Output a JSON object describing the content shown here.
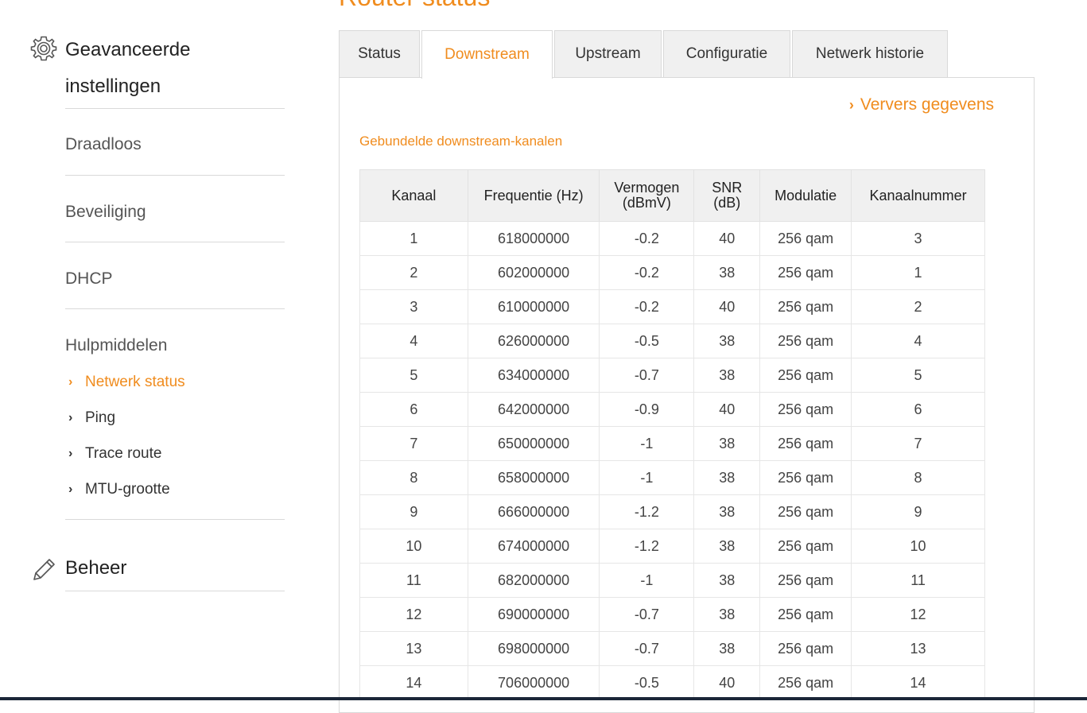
{
  "page_title": "Router status",
  "sidebar": {
    "advanced": {
      "title": "Geavanceerde instellingen",
      "icon": "gear-icon",
      "links": [
        "Draadloos",
        "Beveiliging",
        "DHCP"
      ],
      "tools": {
        "title": "Hulpmiddelen",
        "items": [
          {
            "label": "Netwerk status",
            "active": true
          },
          {
            "label": "Ping",
            "active": false
          },
          {
            "label": "Trace route",
            "active": false
          },
          {
            "label": "MTU-grootte",
            "active": false
          }
        ]
      }
    },
    "manage": {
      "title": "Beheer",
      "icon": "pencil-icon"
    }
  },
  "tabs": [
    {
      "label": "Status",
      "active": false
    },
    {
      "label": "Downstream",
      "active": true
    },
    {
      "label": "Upstream",
      "active": false
    },
    {
      "label": "Configuratie",
      "active": false
    },
    {
      "label": "Netwerk historie",
      "active": false
    }
  ],
  "refresh_label": "Ververs gegevens",
  "table": {
    "caption": "Gebundelde downstream-kanalen",
    "headers": [
      "Kanaal",
      "Frequentie (Hz)",
      "Vermogen (dBmV)",
      "SNR (dB)",
      "Modulatie",
      "Kanaalnummer"
    ],
    "rows": [
      [
        "1",
        "618000000",
        "-0.2",
        "40",
        "256 qam",
        "3"
      ],
      [
        "2",
        "602000000",
        "-0.2",
        "38",
        "256 qam",
        "1"
      ],
      [
        "3",
        "610000000",
        "-0.2",
        "40",
        "256 qam",
        "2"
      ],
      [
        "4",
        "626000000",
        "-0.5",
        "38",
        "256 qam",
        "4"
      ],
      [
        "5",
        "634000000",
        "-0.7",
        "38",
        "256 qam",
        "5"
      ],
      [
        "6",
        "642000000",
        "-0.9",
        "40",
        "256 qam",
        "6"
      ],
      [
        "7",
        "650000000",
        "-1",
        "38",
        "256 qam",
        "7"
      ],
      [
        "8",
        "658000000",
        "-1",
        "38",
        "256 qam",
        "8"
      ],
      [
        "9",
        "666000000",
        "-1.2",
        "38",
        "256 qam",
        "9"
      ],
      [
        "10",
        "674000000",
        "-1.2",
        "38",
        "256 qam",
        "10"
      ],
      [
        "11",
        "682000000",
        "-1",
        "38",
        "256 qam",
        "11"
      ],
      [
        "12",
        "690000000",
        "-0.7",
        "38",
        "256 qam",
        "12"
      ],
      [
        "13",
        "698000000",
        "-0.7",
        "38",
        "256 qam",
        "13"
      ],
      [
        "14",
        "706000000",
        "-0.5",
        "40",
        "256 qam",
        "14"
      ]
    ]
  },
  "colors": {
    "accent": "#f08c1e",
    "header_bg": "#f0f0f0",
    "border": "#d9d9d9"
  }
}
